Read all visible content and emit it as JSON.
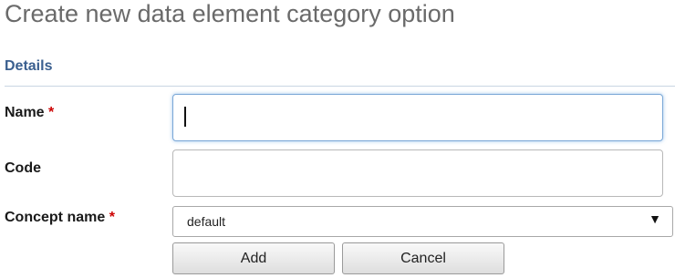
{
  "page": {
    "title": "Create new data element category option"
  },
  "section": {
    "title": "Details"
  },
  "form": {
    "required_marker": "*",
    "name": {
      "label": "Name",
      "value": ""
    },
    "code": {
      "label": "Code",
      "value": ""
    },
    "concept_name": {
      "label": "Concept name",
      "selected": "default",
      "arrow": "▼"
    }
  },
  "buttons": {
    "add": "Add",
    "cancel": "Cancel"
  },
  "colors": {
    "section_header": "#3a5f8f",
    "required": "#cc0000",
    "focus_border": "#7aa7d6"
  }
}
